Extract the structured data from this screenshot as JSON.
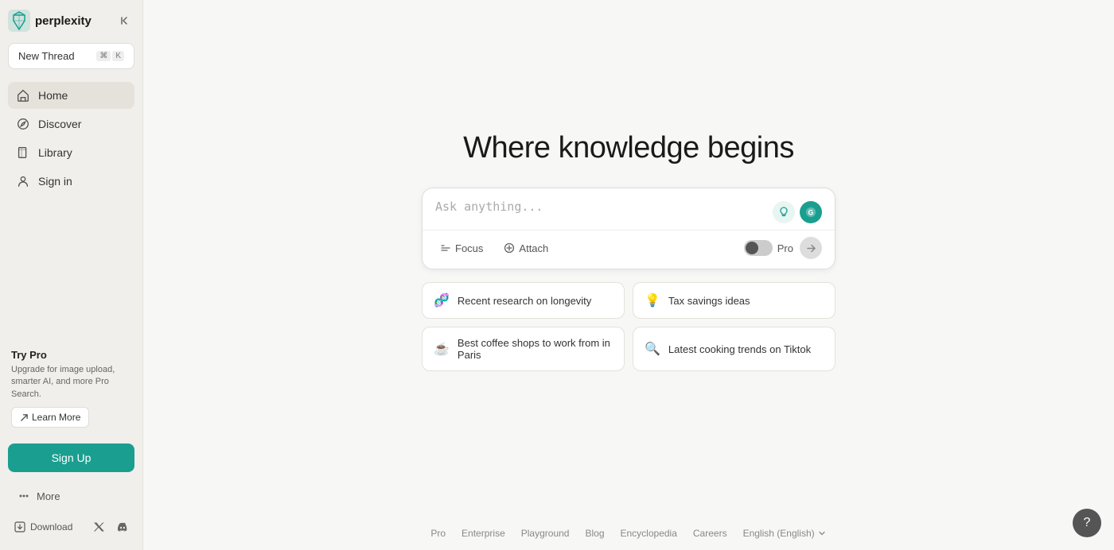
{
  "sidebar": {
    "logo_text": "perplexity",
    "new_thread_label": "New Thread",
    "new_thread_shortcut_cmd": "⌘",
    "new_thread_shortcut_key": "K",
    "nav_items": [
      {
        "id": "home",
        "label": "Home",
        "icon": "home"
      },
      {
        "id": "discover",
        "label": "Discover",
        "icon": "compass"
      },
      {
        "id": "library",
        "label": "Library",
        "icon": "book"
      },
      {
        "id": "signin",
        "label": "Sign in",
        "icon": "user"
      }
    ],
    "sign_up_label": "Sign Up",
    "try_pro": {
      "title": "Try Pro",
      "description": "Upgrade for image upload, smarter AI, and more Pro Search.",
      "learn_more_label": "Learn More"
    },
    "more_label": "More",
    "download_label": "Download"
  },
  "main": {
    "hero_title": "Where knowledge begins",
    "search_placeholder": "Ask anything...",
    "focus_label": "Focus",
    "attach_label": "Attach",
    "pro_label": "Pro",
    "suggestions": [
      {
        "id": "s1",
        "icon": "🧬",
        "text": "Recent research on longevity"
      },
      {
        "id": "s2",
        "icon": "💡",
        "text": "Tax savings ideas"
      },
      {
        "id": "s3",
        "icon": "☕",
        "text": "Best coffee shops to work from in Paris"
      },
      {
        "id": "s4",
        "icon": "🔍",
        "text": "Latest cooking trends on Tiktok"
      }
    ]
  },
  "footer": {
    "links": [
      {
        "id": "pro",
        "label": "Pro"
      },
      {
        "id": "enterprise",
        "label": "Enterprise"
      },
      {
        "id": "playground",
        "label": "Playground"
      },
      {
        "id": "blog",
        "label": "Blog"
      },
      {
        "id": "encyclopedia",
        "label": "Encyclopedia"
      },
      {
        "id": "careers",
        "label": "Careers"
      }
    ],
    "language_label": "English (English)",
    "language_chevron": "∨"
  },
  "colors": {
    "accent": "#1a9e8f",
    "sidebar_bg": "#f0efeb",
    "main_bg": "#f7f7f5"
  }
}
